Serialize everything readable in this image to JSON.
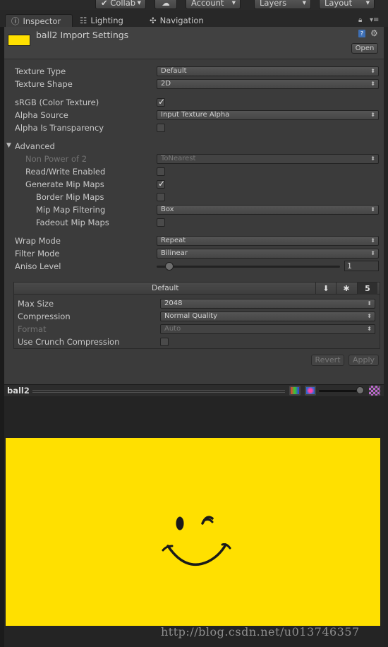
{
  "toolbar": {
    "collab_label": "Collab",
    "cloud_icon": "cloud-icon",
    "account_label": "Account",
    "layers_label": "Layers",
    "layout_label": "Layout"
  },
  "tabs": [
    {
      "label": "Inspector",
      "icon": "info-icon"
    },
    {
      "label": "Lighting",
      "icon": "lighting-icon"
    },
    {
      "label": "Navigation",
      "icon": "navigation-icon"
    }
  ],
  "header": {
    "title": "ball2 Import Settings",
    "open_label": "Open"
  },
  "settings": {
    "texture_type": {
      "label": "Texture Type",
      "value": "Default"
    },
    "texture_shape": {
      "label": "Texture Shape",
      "value": "2D"
    },
    "srgb": {
      "label": "sRGB (Color Texture)",
      "checked": true
    },
    "alpha_source": {
      "label": "Alpha Source",
      "value": "Input Texture Alpha"
    },
    "alpha_is_transparency": {
      "label": "Alpha Is Transparency",
      "checked": false
    },
    "advanced": {
      "label": "Advanced"
    },
    "non_power_of_2": {
      "label": "Non Power of 2",
      "value": "ToNearest"
    },
    "read_write": {
      "label": "Read/Write Enabled",
      "checked": false
    },
    "generate_mip_maps": {
      "label": "Generate Mip Maps",
      "checked": true
    },
    "border_mip_maps": {
      "label": "Border Mip Maps",
      "checked": false
    },
    "mip_map_filtering": {
      "label": "Mip Map Filtering",
      "value": "Box"
    },
    "fadeout_mip_maps": {
      "label": "Fadeout Mip Maps",
      "checked": false
    },
    "wrap_mode": {
      "label": "Wrap Mode",
      "value": "Repeat"
    },
    "filter_mode": {
      "label": "Filter Mode",
      "value": "Bilinear"
    },
    "aniso_level": {
      "label": "Aniso Level",
      "value": "1",
      "level_fraction": 0.0
    }
  },
  "platform": {
    "title": "Default",
    "icons": [
      "download-icon",
      "android-icon",
      "html5-icon"
    ],
    "max_size": {
      "label": "Max Size",
      "value": "2048"
    },
    "compression": {
      "label": "Compression",
      "value": "Normal Quality"
    },
    "format": {
      "label": "Format",
      "value": "Auto"
    },
    "crunch": {
      "label": "Use Crunch Compression",
      "checked": false
    }
  },
  "actions": {
    "revert_label": "Revert",
    "apply_label": "Apply"
  },
  "preview": {
    "name": "ball2",
    "image_color": "#ffe000"
  },
  "watermark": "http://blog.csdn.net/u013746357"
}
